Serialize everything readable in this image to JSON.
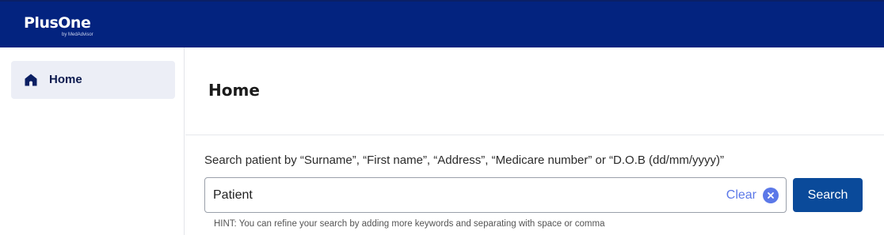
{
  "brand": {
    "name": "PlusOne",
    "tagline": "by MedAdvisor"
  },
  "sidebar": {
    "items": [
      {
        "label": "Home",
        "icon": "home-icon",
        "active": true
      }
    ]
  },
  "page": {
    "title": "Home"
  },
  "search": {
    "caption": "Search patient by “Surname”, “First name”, “Address”, “Medicare number” or “D.O.B (dd/mm/yyyy)”",
    "value": "Patient",
    "clear_label": "Clear",
    "button_label": "Search",
    "hint": "HINT: You can refine your search by adding more keywords and separating with space or comma"
  },
  "colors": {
    "header": "#03237f",
    "accent": "#5b78e8",
    "button": "#0a4a9a",
    "nav_active_bg": "#eceef6"
  }
}
